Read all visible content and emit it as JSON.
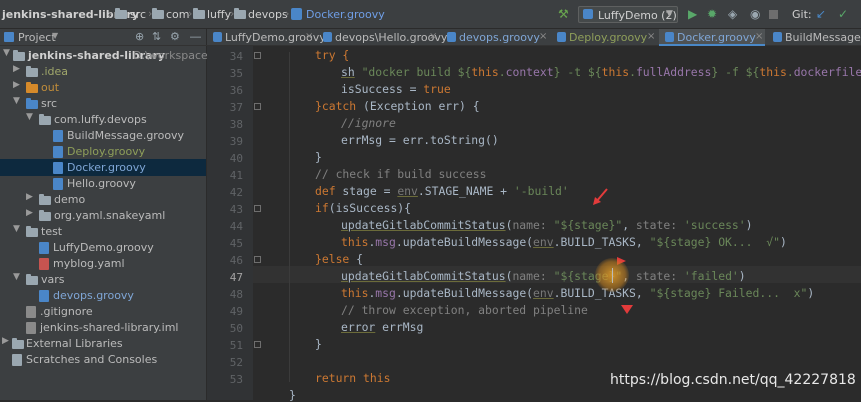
{
  "navbar": {
    "breadcrumbs": [
      "jenkins-shared-library",
      "src",
      "com",
      "luffy",
      "devops",
      "Docker.groovy"
    ],
    "run_config": "LuffyDemo (2)",
    "vcs_label": "Git:"
  },
  "project_panel": {
    "title": "Project",
    "items": [
      {
        "label": "jenkins-shared-library",
        "extra": "D:\\workspace\\lu"
      },
      {
        "label": ".idea"
      },
      {
        "label": "out"
      },
      {
        "label": "src"
      },
      {
        "label": "com.luffy.devops"
      },
      {
        "label": "BuildMessage.groovy"
      },
      {
        "label": "Deploy.groovy"
      },
      {
        "label": "Docker.groovy"
      },
      {
        "label": "Hello.groovy"
      },
      {
        "label": "demo"
      },
      {
        "label": "org.yaml.snakeyaml"
      },
      {
        "label": "test"
      },
      {
        "label": "LuffyDemo.groovy"
      },
      {
        "label": "myblog.yaml"
      },
      {
        "label": "vars"
      },
      {
        "label": "devops.groovy"
      },
      {
        "label": ".gitignore"
      },
      {
        "label": "jenkins-shared-library.iml"
      },
      {
        "label": "External Libraries"
      },
      {
        "label": "Scratches and Consoles"
      }
    ]
  },
  "tabs": [
    "LuffyDemo.groovy",
    "devops\\Hello.groovy",
    "devops.groovy",
    "Deploy.groovy",
    "Docker.groovy",
    "BuildMessage.groovy"
  ],
  "editor": {
    "line_numbers": [
      "34",
      "35",
      "36",
      "37",
      "38",
      "39",
      "40",
      "41",
      "42",
      "43",
      "44",
      "45",
      "46",
      "47",
      "48",
      "49",
      "50",
      "51",
      "52",
      "53"
    ],
    "code": {
      "l34_try": "try {",
      "l35_sh": "sh",
      "l35_str1": "\"docker build ${",
      "l35_this1": "this",
      "l35_dot1": ".",
      "l35_ctx": "context",
      "l35_str2": "} -t ${",
      "l35_this2": "this",
      "l35_fa": "fullAddress",
      "l35_str3": "} -f ${",
      "l35_this3": "this",
      "l35_df": "dockerfile",
      "l35_end": "}",
      "l36_var": "isSuccess = ",
      "l36_true": "true",
      "l37_catch": "}catch",
      "l37_rest": " (Exception err) {",
      "l38_comment": "//ignore",
      "l39_code": "errMsg = err.toString()",
      "l40_code": "}",
      "l41_comment": "// check if build success",
      "l42_def": "def",
      "l42_mid": " stage = ",
      "l42_env": "env",
      "l42_rest": ".STAGE_NAME + ",
      "l42_str": "'-build'",
      "l43_if": "if",
      "l43_rest": "(isSuccess){",
      "l44_fn": "updateGitlabCommitStatus",
      "l44_p1": "(",
      "l44_name": "name: ",
      "l44_s1": "\"${stage}\"",
      "l44_c": ", ",
      "l44_state": "state: ",
      "l44_s2": "'success'",
      "l44_close": ")",
      "l45_this": "this",
      "l45_dot": ".",
      "l45_msg": "msg",
      "l45_m": ".updateBuildMessage(",
      "l45_env": "env",
      "l45_bt": ".BUILD_TASKS, ",
      "l45_s": "\"${stage} OK...  √\"",
      "l45_close": ")",
      "l46_else": "}else",
      "l46_rest": " {",
      "l47_fn": "updateGitlabCommitStatus",
      "l47_p1": "(",
      "l47_name": "name: ",
      "l47_s1": "\"${stage}\"",
      "l47_c": ", ",
      "l47_state": "state: ",
      "l47_s2": "'failed'",
      "l47_close": ")",
      "l48_this": "this",
      "l48_dot": ".",
      "l48_msg": "msg",
      "l48_m": ".updateBuildMessage(",
      "l48_env": "env",
      "l48_bt": ".BUILD_TASKS, ",
      "l48_s": "\"${stage} Failed...  x\"",
      "l48_close": ")",
      "l49_comment": "// throw exception, aborted pipeline",
      "l50_error": "error",
      "l50_rest": " errMsg",
      "l51_code": "}",
      "l53_return": "return",
      "l53_this": " this",
      "l54_code": "}"
    }
  },
  "watermark": "https://blog.csdn.net/qq_42227818",
  "colors": {
    "keyword": "#cc7832",
    "string": "#6a8759",
    "field": "#9876aa",
    "comment": "#808080",
    "accent": "#4a88c7"
  }
}
